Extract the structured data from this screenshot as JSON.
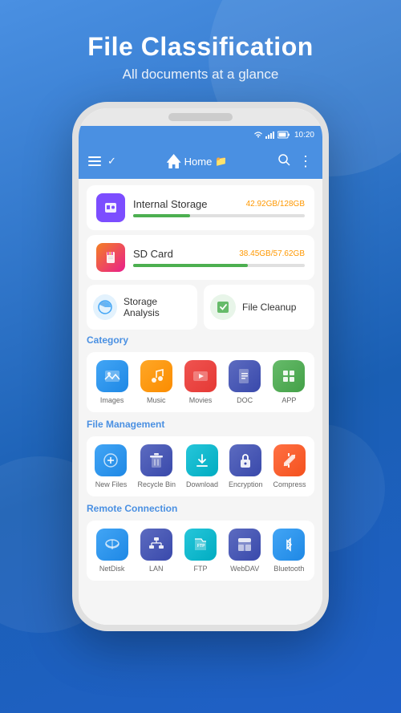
{
  "page": {
    "title": "File Classification",
    "subtitle": "All documents at a glance"
  },
  "status_bar": {
    "time": "10:20",
    "wifi": "wifi",
    "signal": "signal",
    "battery": "battery"
  },
  "toolbar": {
    "home_label": "Home",
    "search_label": "Search",
    "menu_label": "More"
  },
  "storage": [
    {
      "name": "Internal Storage",
      "used": "42.92GB",
      "total": "128GB",
      "percent": 33,
      "icon": "💾",
      "icon_class": "storage-icon-internal"
    },
    {
      "name": "SD Card",
      "used": "38.45GB",
      "total": "57.62GB",
      "percent": 67,
      "icon": "📱",
      "icon_class": "storage-icon-sd"
    }
  ],
  "quick_actions": [
    {
      "label": "Storage Analysis",
      "icon": "🔵",
      "icon_class": "icon-newfiles"
    },
    {
      "label": "File Cleanup",
      "icon": "🟩",
      "icon_class": "icon-app"
    }
  ],
  "sections": [
    {
      "title": "Category",
      "items": [
        {
          "label": "Images",
          "icon": "🏔️",
          "icon_class": "icon-images"
        },
        {
          "label": "Music",
          "icon": "🎵",
          "icon_class": "icon-music"
        },
        {
          "label": "Movies",
          "icon": "🎬",
          "icon_class": "icon-movies"
        },
        {
          "label": "DOC",
          "icon": "📄",
          "icon_class": "icon-doc"
        },
        {
          "label": "APP",
          "icon": "📱",
          "icon_class": "icon-app"
        }
      ]
    },
    {
      "title": "File Management",
      "items": [
        {
          "label": "New Files",
          "icon": "📋",
          "icon_class": "icon-newfiles"
        },
        {
          "label": "Recycle Bin",
          "icon": "🗑️",
          "icon_class": "icon-recycle"
        },
        {
          "label": "Download",
          "icon": "⬇️",
          "icon_class": "icon-download"
        },
        {
          "label": "Encryption",
          "icon": "🔒",
          "icon_class": "icon-encrypt"
        },
        {
          "label": "Compress",
          "icon": "📦",
          "icon_class": "icon-compress"
        }
      ]
    },
    {
      "title": "Remote Connection",
      "items": [
        {
          "label": "NetDisk",
          "icon": "☁️",
          "icon_class": "icon-netdisk"
        },
        {
          "label": "LAN",
          "icon": "📡",
          "icon_class": "icon-lan"
        },
        {
          "label": "FTP",
          "icon": "📂",
          "icon_class": "icon-ftp"
        },
        {
          "label": "WebDAV",
          "icon": "🗂️",
          "icon_class": "icon-webdav"
        },
        {
          "label": "Bluetooth",
          "icon": "🔷",
          "icon_class": "icon-bluetooth"
        }
      ]
    }
  ]
}
